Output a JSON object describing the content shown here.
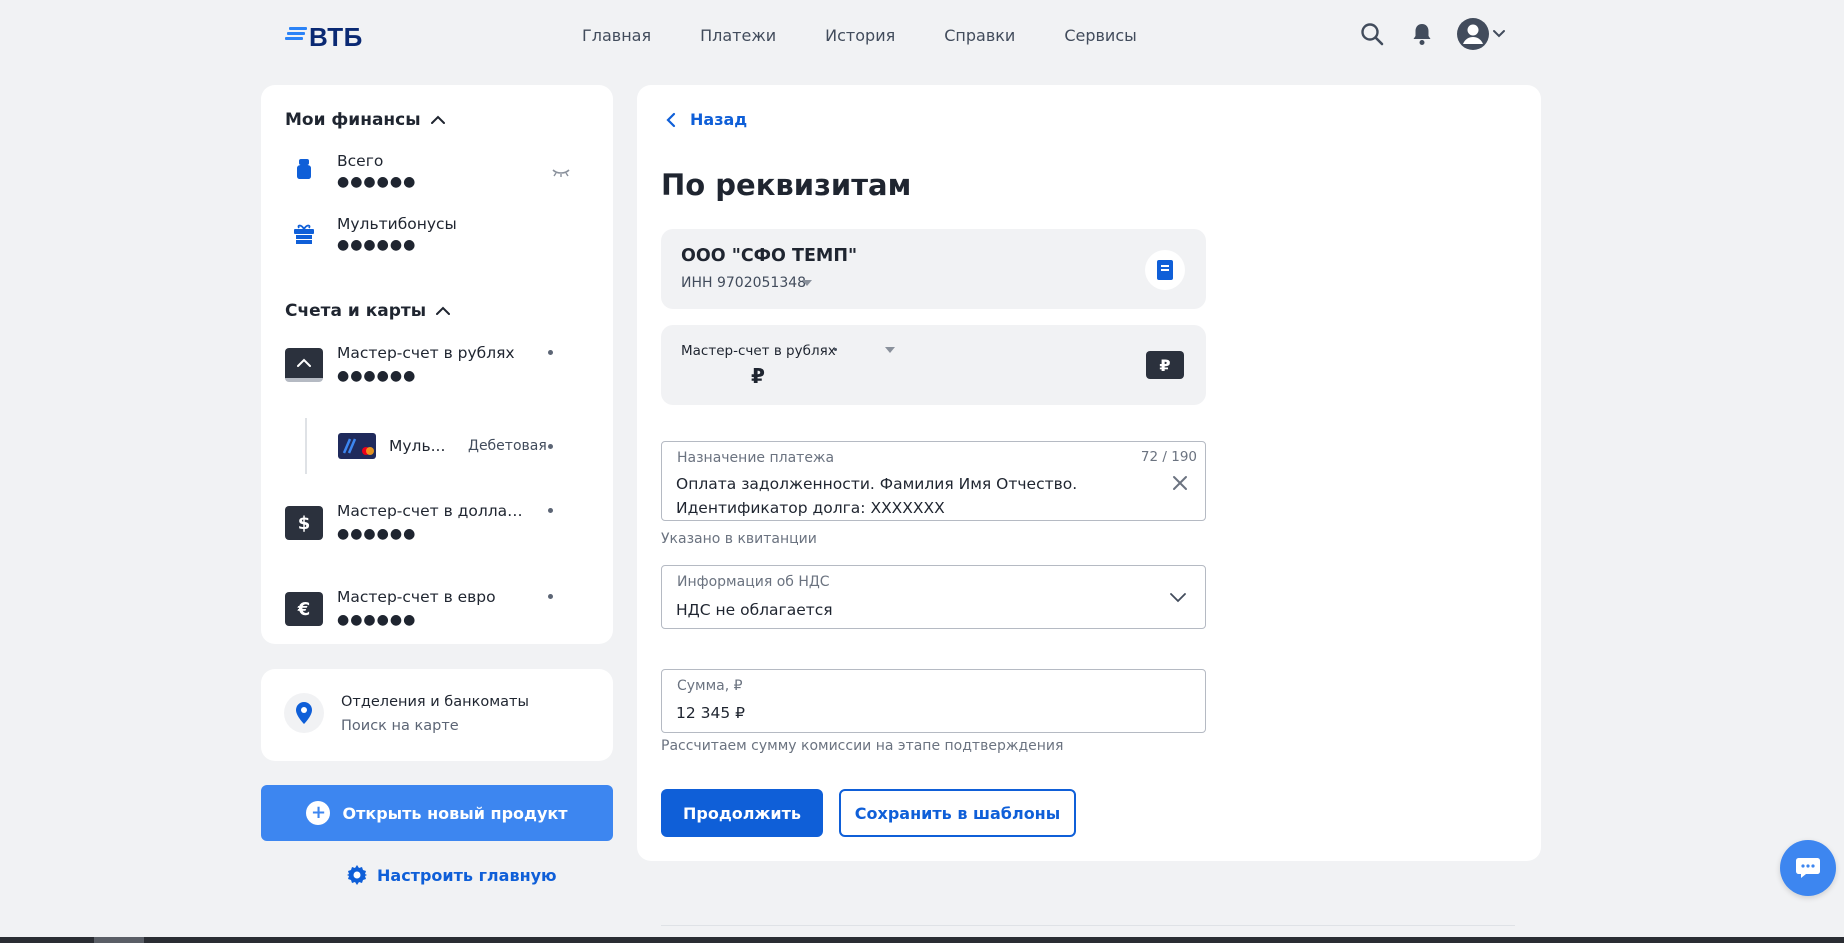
{
  "header": {
    "logo_text": "ВТБ",
    "nav": [
      "Главная",
      "Платежи",
      "История",
      "Справки",
      "Сервисы"
    ]
  },
  "sidebar": {
    "finances": {
      "title": "Мои финансы",
      "items": [
        {
          "label": "Всего",
          "value": "●●●●●●"
        },
        {
          "label": "Мультибонусы",
          "value": "●●●●●●"
        }
      ]
    },
    "accounts": {
      "title": "Счета и карты",
      "items": [
        {
          "label": "Мастер-счет в рублях",
          "value": "●●●●●●"
        },
        {
          "label": "Муль...",
          "type": "Дебетовая"
        },
        {
          "label": "Мастер-счет в доллар...",
          "value": "●●●●●●",
          "icon_text": "$"
        },
        {
          "label": "Мастер-счет в евро",
          "value": "●●●●●●",
          "icon_text": "€"
        }
      ]
    },
    "branches": {
      "title": "Отделения и банкоматы",
      "subtitle": "Поиск на карте"
    },
    "open_product": "Открыть новый продукт",
    "customize": "Настроить главную"
  },
  "main": {
    "back": "Назад",
    "title": "По реквизитам",
    "recipient": {
      "name": "ООО \"СФО ТЕМП\"",
      "inn": "ИНН 9702051348"
    },
    "account": {
      "label": "Мастер-счет в рублях",
      "currency": "₽",
      "badge": "₽"
    },
    "purpose": {
      "label": "Назначение платежа",
      "counter": "72 / 190",
      "line1": "Оплата задолженности. Фамилия Имя Отчество.",
      "line2": "Идентификатор долга: XXXXXXX",
      "hint": "Указано в квитанции"
    },
    "nds": {
      "label": "Информация об НДС",
      "value": "НДС не облагается"
    },
    "sum": {
      "label": "Сумма, ₽",
      "value": "12 345 ₽",
      "hint": "Рассчитаем сумму комиссии на этапе подтверждения"
    },
    "continue": "Продолжить",
    "save_template": "Сохранить в шаблоны"
  },
  "colors": {
    "accent": "#0f5fd8",
    "accent_light": "#3d86f0",
    "background": "#f1f2f4",
    "dark": "#2b313d"
  }
}
